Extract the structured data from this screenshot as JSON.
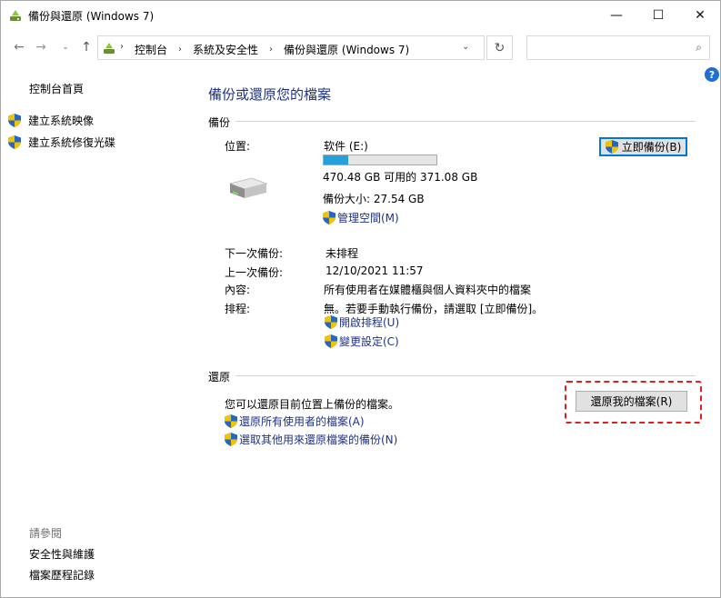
{
  "window": {
    "title": "備份與還原 (Windows 7)"
  },
  "titlebar": {
    "minimize": "—",
    "maximize": "☐",
    "close": "✕"
  },
  "nav": {
    "back": "←",
    "forward": "→",
    "dropdown": "⌄",
    "up": "↑",
    "breadcrumbs": [
      "控制台",
      "系統及安全性",
      "備份與還原 (Windows 7)"
    ],
    "crumb_sep": "›",
    "address_dropdown": "⌄",
    "refresh": "↻",
    "search_placeholder": "",
    "search_glyph": "⌕"
  },
  "help": "?",
  "left_pane": {
    "home": "控制台首頁",
    "tasks": [
      "建立系統映像",
      "建立系統修復光碟"
    ],
    "see_also_title": "請參閱",
    "see_also": [
      "安全性與維護",
      "檔案歷程記錄"
    ]
  },
  "main": {
    "title": "備份或還原您的檔案",
    "backup": {
      "section_label": "備份",
      "location_label": "位置:",
      "drive_name": "软件 (E:)",
      "usage_fraction": 0.22,
      "space_text": "470.48 GB 可用的 371.08 GB",
      "backup_size": "備份大小: 27.54 GB",
      "manage_space": "管理空間(M)",
      "backup_now": "立即備份(B)",
      "next_label": "下一次備份:",
      "next_value": "未排程",
      "last_label": "上一次備份:",
      "last_value": "12/10/2021 11:57",
      "contents_label": "內容:",
      "contents_value": "所有使用者在媒體櫃與個人資料夾中的檔案",
      "schedule_label": "排程:",
      "schedule_value": "無。若要手動執行備份，請選取 [立即備份]。",
      "turn_on_schedule": "開啟排程(U)",
      "change_settings": "變更設定(C)"
    },
    "restore": {
      "section_label": "還原",
      "description": "您可以還原目前位置上備份的檔案。",
      "restore_my_files": "還原我的檔案(R)",
      "restore_all_users": "還原所有使用者的檔案(A)",
      "select_other": "選取其他用來還原檔案的備份(N)"
    }
  }
}
